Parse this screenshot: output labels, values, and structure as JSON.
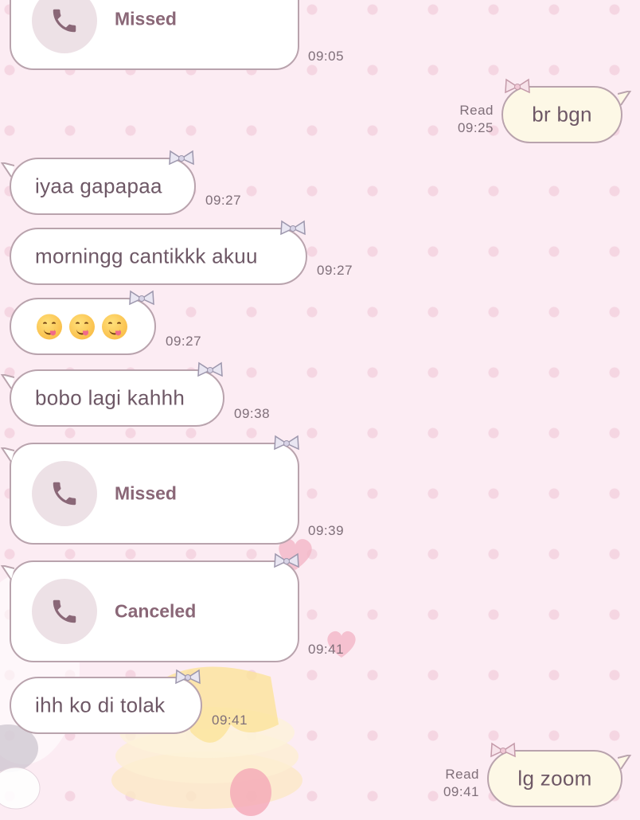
{
  "colors": {
    "background": "#fcecf3",
    "incoming_bubble": "#ffffff",
    "outgoing_bubble": "#fdf8e6",
    "bubble_border": "#b9a3ad",
    "text": "#6e5866",
    "call_label": "#8a6777"
  },
  "messages": [
    {
      "type": "call",
      "direction": "incoming",
      "label": "Missed",
      "time": "09:05",
      "icon": "phone-icon"
    },
    {
      "type": "text",
      "direction": "outgoing",
      "text": "br bgn",
      "status": "Read",
      "time": "09:25"
    },
    {
      "type": "text",
      "direction": "incoming",
      "text": "iyaa gapapaa",
      "time": "09:27"
    },
    {
      "type": "text",
      "direction": "incoming",
      "text": "morningg cantikkk akuu",
      "time": "09:27"
    },
    {
      "type": "emoji",
      "direction": "incoming",
      "emoji": [
        "smiling-face-icon",
        "smiling-face-icon",
        "smiling-face-icon"
      ],
      "time": "09:27"
    },
    {
      "type": "text",
      "direction": "incoming",
      "text": "bobo lagi kahhh",
      "time": "09:38"
    },
    {
      "type": "call",
      "direction": "incoming",
      "label": "Missed",
      "time": "09:39",
      "icon": "phone-icon"
    },
    {
      "type": "call",
      "direction": "incoming",
      "label": "Canceled",
      "time": "09:41",
      "icon": "phone-icon"
    },
    {
      "type": "text",
      "direction": "incoming",
      "text": "ihh ko di tolak",
      "time": "09:41"
    },
    {
      "type": "text",
      "direction": "outgoing",
      "text": "lg zoom",
      "status": "Read",
      "time": "09:41"
    }
  ]
}
